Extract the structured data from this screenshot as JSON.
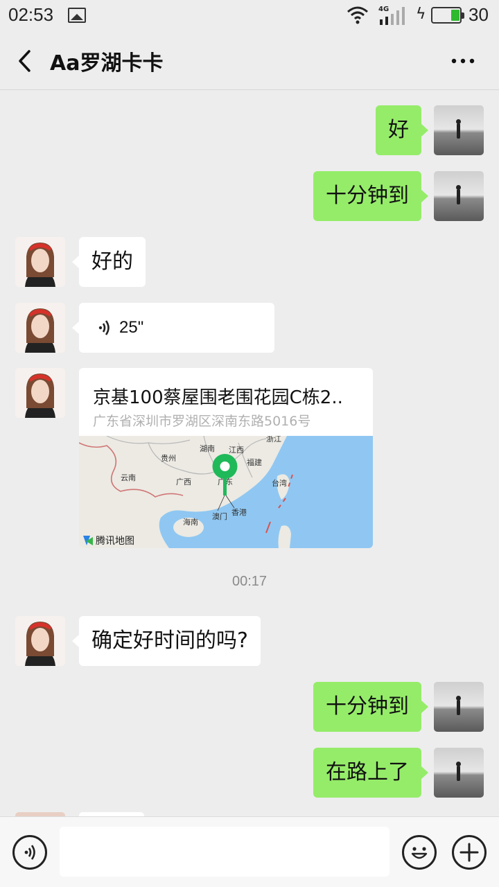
{
  "status_bar": {
    "time": "02:53",
    "network": "4G",
    "battery": "30",
    "icons": [
      "image-icon",
      "wifi-icon",
      "signal-icon",
      "charging-icon",
      "battery-icon"
    ]
  },
  "header": {
    "title": "Aa罗湖卡卡",
    "back_icon": "chevron-left-icon",
    "more_icon": "more-dots-icon"
  },
  "messages": [
    {
      "from": "me",
      "type": "text",
      "text": "好"
    },
    {
      "from": "me",
      "type": "text",
      "text": "十分钟到"
    },
    {
      "from": "them",
      "type": "text",
      "text": "好的"
    },
    {
      "from": "them",
      "type": "voice",
      "duration": "25\""
    },
    {
      "from": "them",
      "type": "location",
      "title": "京基100蔡屋围老围花园C栋2..",
      "address": "广东省深圳市罗湖区深南东路5016号",
      "map_labels": [
        "湖南",
        "江西",
        "浙江",
        "贵州",
        "福建",
        "云南",
        "广西",
        "广东",
        "台湾",
        "海南",
        "澳门",
        "香港"
      ],
      "map_provider": "腾讯地图"
    },
    {
      "type": "timestamp",
      "text": "00:17"
    },
    {
      "from": "them",
      "type": "text",
      "text": "确定好时间的吗?"
    },
    {
      "from": "me",
      "type": "text",
      "text": "十分钟到"
    },
    {
      "from": "me",
      "type": "text",
      "text": "在路上了"
    }
  ],
  "input_bar": {
    "voice_icon": "voice-mode-icon",
    "input_value": "",
    "emoji_icon": "emoji-icon",
    "plus_icon": "plus-icon"
  },
  "colors": {
    "background": "#ededed",
    "my_bubble": "#95ec69",
    "their_bubble": "#ffffff",
    "map_water": "#8fc7f2",
    "pin": "#1fb95a"
  }
}
